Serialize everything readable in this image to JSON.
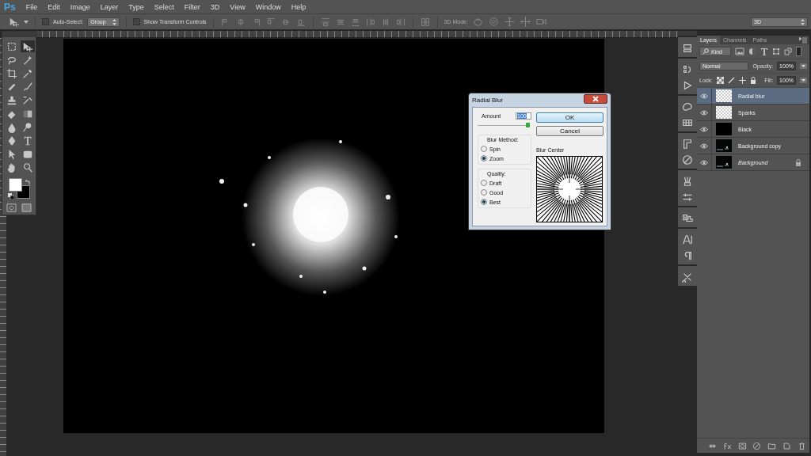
{
  "app": {
    "logo": "Ps"
  },
  "menu": [
    "File",
    "Edit",
    "Image",
    "Layer",
    "Type",
    "Select",
    "Filter",
    "3D",
    "View",
    "Window",
    "Help"
  ],
  "options_bar": {
    "auto_select": {
      "label": "Auto-Select:",
      "checked": false
    },
    "auto_select_target": "Group",
    "show_transform": {
      "label": "Show Transform Controls",
      "checked": false
    },
    "mode_label": "3D Mode:",
    "workspace": "3D"
  },
  "toolbox": {
    "tools": [
      {
        "selected": false
      },
      {
        "selected": true
      },
      {
        "selected": false
      },
      {
        "selected": false
      },
      {
        "selected": false
      },
      {
        "selected": false
      },
      {
        "selected": false
      },
      {
        "selected": false
      },
      {
        "selected": false
      },
      {
        "selected": false
      },
      {
        "selected": false
      },
      {
        "selected": false
      },
      {
        "selected": false
      },
      {
        "selected": false
      },
      {
        "selected": false
      },
      {
        "selected": false
      },
      {
        "selected": false
      },
      {
        "selected": false
      },
      {
        "selected": false
      },
      {
        "selected": false
      }
    ]
  },
  "dialog": {
    "title": "Radial Blur",
    "amount_label": "Amount",
    "amount": "100",
    "amount_slider": {
      "level": 1
    },
    "ok": "OK",
    "cancel": "Cancel",
    "method_label": "Blur Method:",
    "methods": [
      {
        "label": "Spin",
        "selected": false
      },
      {
        "label": "Zoom",
        "selected": true
      }
    ],
    "quality_label": "Quality:",
    "qualities": [
      {
        "label": "Draft",
        "selected": false
      },
      {
        "label": "Good",
        "selected": false
      },
      {
        "label": "Best",
        "selected": true
      }
    ],
    "center_label": "Blur Center"
  },
  "layers_panel": {
    "tabs": [
      {
        "label": "Layers",
        "selected": true
      },
      {
        "label": "Channels",
        "selected": false
      },
      {
        "label": "Paths",
        "selected": false
      }
    ],
    "filter": "Kind",
    "blend_mode": "Normal",
    "opacity_label": "Opacity:",
    "opacity": "100%",
    "lock_label": "Lock:",
    "fill_label": "Fill:",
    "fill": "100%",
    "layers": [
      {
        "name": "Radial blur",
        "selected": true,
        "visible": true,
        "kind": "transparent",
        "locked": false
      },
      {
        "name": "Sparks",
        "selected": false,
        "visible": true,
        "kind": "transparent",
        "locked": false
      },
      {
        "name": "Black",
        "selected": false,
        "visible": true,
        "kind": "black",
        "locked": false
      },
      {
        "name": "Background copy",
        "selected": false,
        "visible": true,
        "locked": false
      },
      {
        "name": "Background",
        "selected": false,
        "visible": true,
        "locked": true
      }
    ]
  }
}
